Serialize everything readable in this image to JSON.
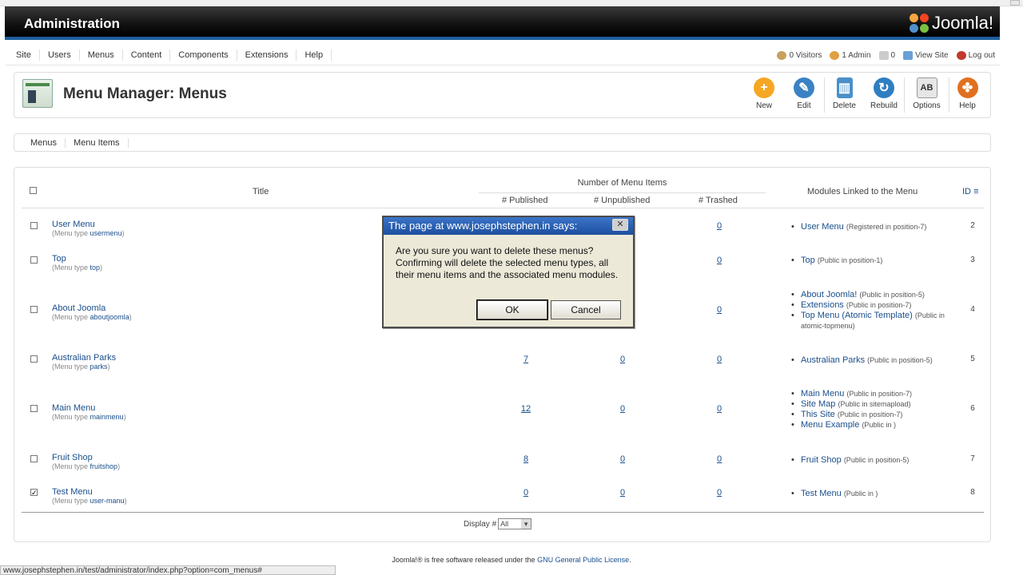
{
  "header": {
    "title": "Administration",
    "logo_text": "Joomla!"
  },
  "mainmenu": [
    "Site",
    "Users",
    "Menus",
    "Content",
    "Components",
    "Extensions",
    "Help"
  ],
  "status": {
    "visitors": "0 Visitors",
    "admins": "1 Admin",
    "messages": "0",
    "view_site": "View Site",
    "logout": "Log out"
  },
  "page_title": "Menu Manager: Menus",
  "toolbar": {
    "new": "New",
    "edit": "Edit",
    "delete": "Delete",
    "rebuild": "Rebuild",
    "options": "Options",
    "help": "Help"
  },
  "submenu": [
    "Menus",
    "Menu Items"
  ],
  "table": {
    "col_title": "Title",
    "col_group": "Number of Menu Items",
    "col_published": "# Published",
    "col_unpublished": "# Unpublished",
    "col_trashed": "# Trashed",
    "col_modules": "Modules Linked to the Menu",
    "col_id": "ID",
    "menu_type_prefix": "(Menu type",
    "rows": [
      {
        "title": "User Menu",
        "type": "usermenu",
        "published": "",
        "unpublished": "",
        "trashed": "0",
        "id": "2",
        "checked": false,
        "modules": [
          {
            "name": "User Menu",
            "info": "(Registered in position-7)"
          }
        ]
      },
      {
        "title": "Top",
        "type": "top",
        "published": "",
        "unpublished": "",
        "trashed": "0",
        "id": "3",
        "checked": false,
        "modules": [
          {
            "name": "Top",
            "info": "(Public in position-1)"
          }
        ]
      },
      {
        "title": "About Joomla",
        "type": "aboutjoomla",
        "published": "",
        "unpublished": "",
        "trashed": "0",
        "id": "4",
        "checked": false,
        "modules": [
          {
            "name": "About Joomla!",
            "info": "(Public in position-5)"
          },
          {
            "name": "Extensions",
            "info": "(Public in position-7)"
          },
          {
            "name": "Top Menu (Atomic Template)",
            "info": "(Public in atomic-topmenu)"
          }
        ]
      },
      {
        "title": "Australian Parks",
        "type": "parks",
        "published": "7",
        "unpublished": "0",
        "trashed": "0",
        "id": "5",
        "checked": false,
        "modules": [
          {
            "name": "Australian Parks",
            "info": "(Public in position-5)"
          }
        ]
      },
      {
        "title": "Main Menu",
        "type": "mainmenu",
        "published": "12",
        "unpublished": "0",
        "trashed": "0",
        "id": "6",
        "checked": false,
        "modules": [
          {
            "name": "Main Menu",
            "info": "(Public in position-7)"
          },
          {
            "name": "Site Map",
            "info": "(Public in sitemapload)"
          },
          {
            "name": "This Site",
            "info": "(Public in position-7)"
          },
          {
            "name": "Menu Example",
            "info": "(Public in )"
          }
        ]
      },
      {
        "title": "Fruit Shop",
        "type": "fruitshop",
        "published": "8",
        "unpublished": "0",
        "trashed": "0",
        "id": "7",
        "checked": false,
        "modules": [
          {
            "name": "Fruit Shop",
            "info": "(Public in position-5)"
          }
        ]
      },
      {
        "title": "Test Menu",
        "type": "user-manu",
        "published": "0",
        "unpublished": "0",
        "trashed": "0",
        "id": "8",
        "checked": true,
        "modules": [
          {
            "name": "Test Menu",
            "info": "(Public in )"
          }
        ]
      }
    ]
  },
  "display": {
    "label": "Display #",
    "value": "All"
  },
  "footer": {
    "text_pre": "Joomla!® is free software released under the",
    "link": "GNU General Public License",
    "text_post": "."
  },
  "statusbar_url": "www.josephstephen.in/test/administrator/index.php?option=com_menus#",
  "dialog": {
    "title": "The page at www.josephstephen.in says:",
    "message": "Are you sure you want to delete these menus? Confirming will delete the selected menu types, all their menu items and the associated menu modules.",
    "ok": "OK",
    "cancel": "Cancel"
  }
}
